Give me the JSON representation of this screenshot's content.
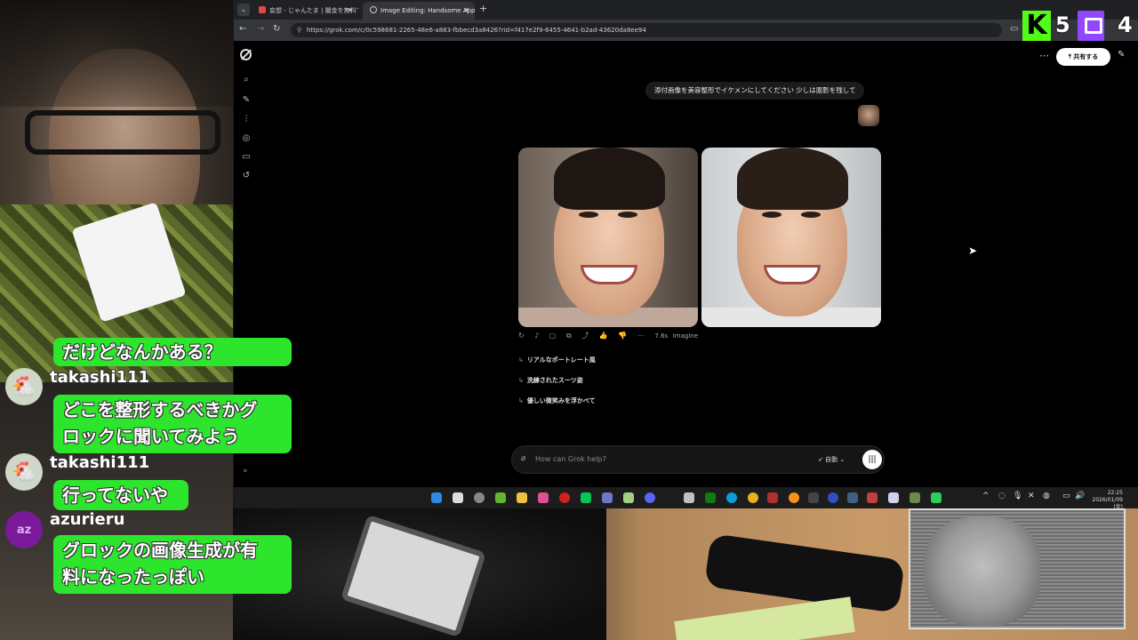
{
  "browser": {
    "tabs": [
      {
        "label": "妄想 - じゃんたま | 闇金を無料で..."
      },
      {
        "label": "Image Editing: Handsome App..."
      }
    ],
    "url": "https://grok.com/c/0c598681-2265-48e6-a883-fbbecd3a8426?rid=f417e2f9-6455-4641-b2ad-43620da8ee94"
  },
  "grok": {
    "share_label": "共有する",
    "user_message": "添付画像を美容整形でイケメンにしてください 少しは面影を残して",
    "response_meta": {
      "time": "7.6s",
      "model": "Imagine"
    },
    "suggestions": [
      "リアルなポートレート風",
      "洗練されたスーツ姿",
      "優しい微笑みを浮かべて"
    ],
    "input_placeholder": "How can Grok help?",
    "mode_label": "自動"
  },
  "taskbar": {
    "time": "22:25",
    "date": "2026/01/09 (金)"
  },
  "chat": {
    "messages": [
      {
        "user": "",
        "lines": [
          "だけどなんかある？"
        ]
      },
      {
        "user": "takashi111",
        "lines": [
          "どこを整形するべきかグ",
          "ロックに聞いてみよう"
        ]
      },
      {
        "user": "takashi111",
        "lines": [
          "行ってないや"
        ]
      },
      {
        "user": "azurieru",
        "lines": [
          "グロックの画像生成が有",
          "料になったっぽい"
        ]
      }
    ],
    "avatar_initials": "az"
  },
  "overlay": {
    "kick_icon": "K",
    "kick_count": "5",
    "twitch_count": "4"
  },
  "colors": {
    "chat_bubble": "#2ee52e",
    "kick_green": "#53fc18",
    "twitch_purple": "#9146ff",
    "browser_bg": "#000000"
  }
}
